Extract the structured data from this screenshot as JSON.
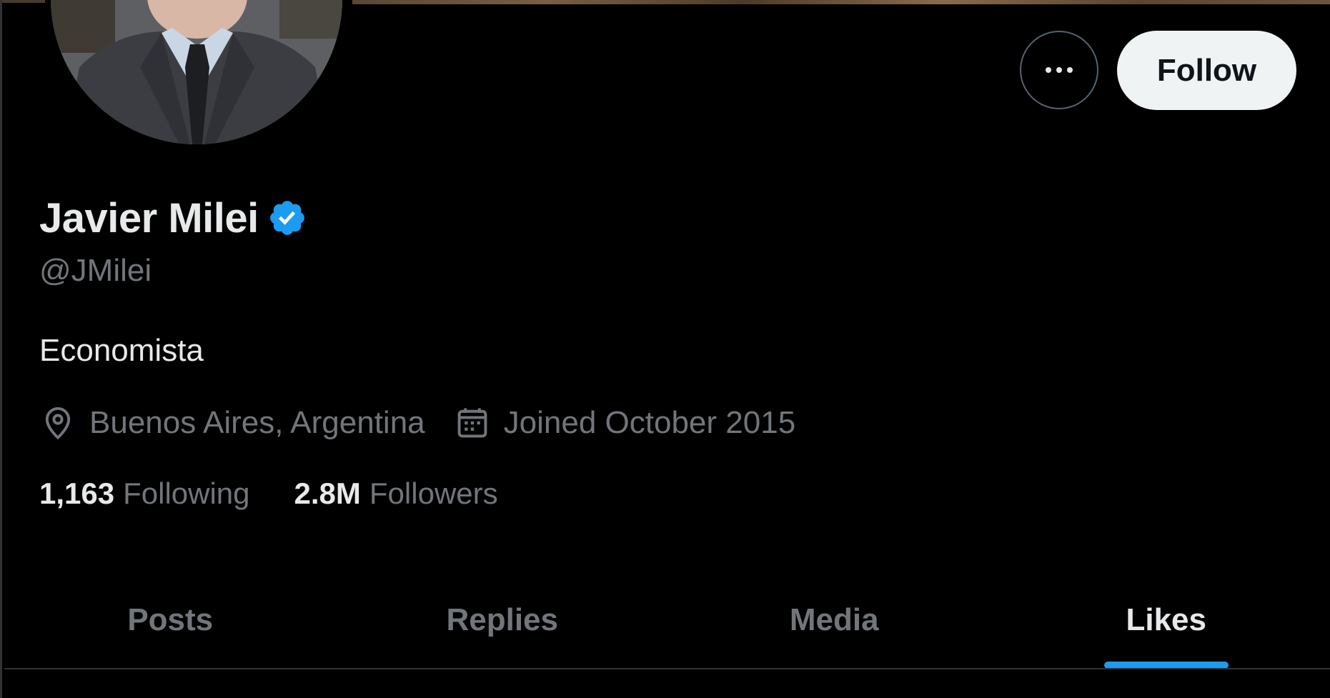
{
  "profile": {
    "name": "Javier Milei",
    "handle": "@JMilei",
    "bio": "Economista",
    "location": "Buenos Aires, Argentina",
    "joined": "Joined October 2015",
    "following_count": "1,163",
    "following_label": "Following",
    "followers_count": "2.8M",
    "followers_label": "Followers",
    "verified": true
  },
  "actions": {
    "follow_label": "Follow",
    "more_icon": "more-horizontal-icon"
  },
  "tabs": [
    {
      "label": "Posts",
      "active": false
    },
    {
      "label": "Replies",
      "active": false
    },
    {
      "label": "Media",
      "active": false
    },
    {
      "label": "Likes",
      "active": true
    }
  ],
  "colors": {
    "background": "#000000",
    "primary_text": "#e7e9ea",
    "secondary_text": "#71767b",
    "accent": "#1d9bf0",
    "follow_button_bg": "#eff3f4",
    "border": "#2f3336"
  },
  "icons": {
    "verified": "verified-badge-icon",
    "location": "location-pin-icon",
    "calendar": "calendar-icon"
  }
}
